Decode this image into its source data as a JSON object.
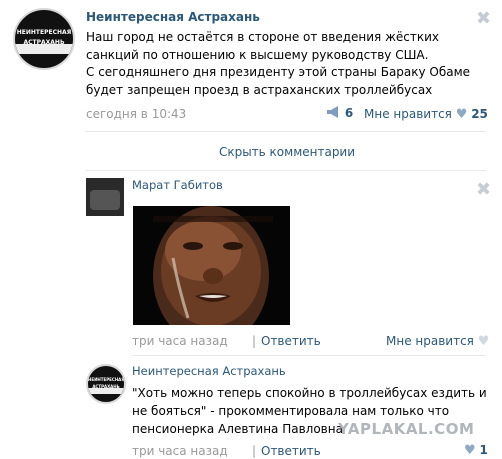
{
  "post": {
    "author": "Неинтересная Астрахань",
    "avatar_text": "НЕИНТЕРЕСНАЯ\nАСТРАХАНЬ",
    "lines": [
      "Наш город не остаётся в стороне от введения жёстких",
      "санкций по отношению к высшему руководству США.",
      "С сегодняшнего дня президенту этой страны Бараку Обаме",
      "будет запрещен проезд в астраханских троллейбусах"
    ],
    "time": "сегодня в 10:43",
    "reposts": "6",
    "like_label": "Мне нравится",
    "likes": "25",
    "repost_icon": "megaphone-icon",
    "heart_icon": "heart-icon"
  },
  "hide_comments": "Скрыть комментарии",
  "comments": [
    {
      "author": "Марат Габитов",
      "time": "три часа назад",
      "reply": "Ответить",
      "like_label": "Мне нравится",
      "sep": "|"
    },
    {
      "author": "Неинтересная Астрахань",
      "lines": [
        "\"Хоть можно теперь спокойно в троллейбусах ездить и",
        "не бояться\" - прокомментировала нам только что",
        "пенсионерка Алевтина Павловна"
      ],
      "time": "три часа назад",
      "reply": "Ответить",
      "sep": "|",
      "likes": "1"
    }
  ],
  "watermark": "YAPLAKAL.COM",
  "colors": {
    "link": "#2b587a",
    "meta": "#999999",
    "heart": "#8fa8c5"
  }
}
